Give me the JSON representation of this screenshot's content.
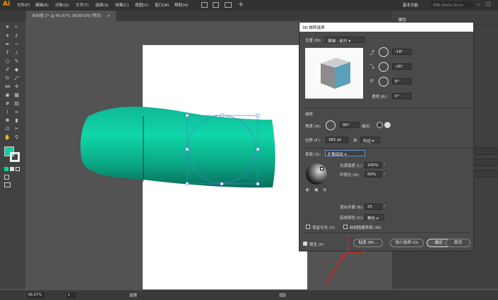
{
  "app": {
    "logo": "Ai"
  },
  "menus": [
    "文件(F)",
    "编辑(E)",
    "对象(O)",
    "文字(T)",
    "选择(S)",
    "效果(C)",
    "视图(V)",
    "窗口(W)",
    "帮助(H)"
  ],
  "header_right": {
    "workspace": "基本功能",
    "search_placeholder": "搜索 Adobe Stock"
  },
  "document_tab": {
    "title": "未标题-2* @ 66.67% (RGB/GPU 预览)",
    "close": "×"
  },
  "right_panel": {
    "tab": "属性"
  },
  "status": {
    "zoom": "66.67%",
    "page": "1",
    "tool": "选择"
  },
  "dialog": {
    "title": "3D 绕转选项",
    "position_label": "位置 (N):",
    "position_value": "离轴 - 前方",
    "rot_x": "-18°",
    "rot_y": "-26°",
    "rot_z": "8°",
    "perspective_label": "透视 (R):",
    "perspective_value": "0°",
    "revolve_header": "绕转",
    "angle_label": "角度 (A):",
    "angle_value": "90°",
    "cap_label": "端点:",
    "offset_label": "位移 (F):",
    "offset_value": "381 pt",
    "offset_from_label": "自",
    "offset_from_value": "右边",
    "surface_label": "表面 (S):",
    "surface_value": "扩散底纹",
    "light_intensity_label": "光源强度 (L):",
    "light_intensity_value": "100%",
    "ambient_label": "环境光 (A):",
    "ambient_value": "50%",
    "blend_steps_label": "混合步骤 (B):",
    "blend_steps_value": "25",
    "shading_color_label": "底纹颜色 (C):",
    "shading_color_value": "黑色",
    "preserve_spot_label": "保留专色 (V)",
    "draw_hidden_label": "绘制隐藏表面 (W)",
    "preview_label": "预览 (P)",
    "map_button": "贴图 (M)...",
    "fewer_options_button": "较少选项 (O)",
    "ok_button": "确定",
    "cancel_button": "取消"
  },
  "colors": {
    "accent_teal": "#0ad1a4",
    "tube_dark": "#0a7d66",
    "cube_front": "#5aa0bb",
    "highlight_red": "#e02020"
  }
}
